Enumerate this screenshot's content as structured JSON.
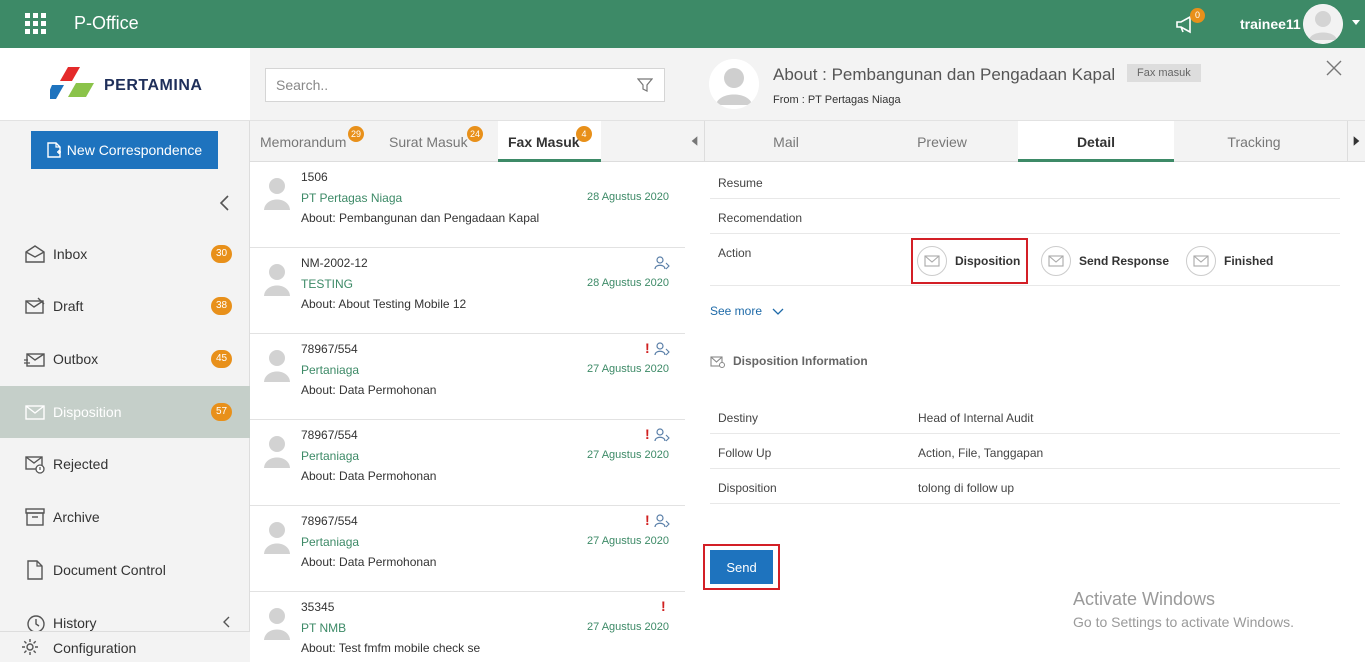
{
  "app": {
    "title": "P-Office",
    "notification_count": "0",
    "username": "trainee11"
  },
  "sidebar": {
    "logo_text": "PERTAMINA",
    "new_button": "New Correspondence",
    "items": [
      {
        "label": "Inbox",
        "badge": "30",
        "icon": "inbox-icon"
      },
      {
        "label": "Draft",
        "badge": "38",
        "icon": "draft-icon"
      },
      {
        "label": "Outbox",
        "badge": "45",
        "icon": "outbox-icon"
      },
      {
        "label": "Disposition",
        "badge": "57",
        "icon": "disposition-icon"
      },
      {
        "label": "Rejected",
        "badge": "",
        "icon": "rejected-icon"
      },
      {
        "label": "Archive",
        "badge": "",
        "icon": "archive-icon"
      },
      {
        "label": "Document Control",
        "badge": "",
        "icon": "document-icon"
      },
      {
        "label": "History",
        "badge": "",
        "icon": "history-icon"
      }
    ],
    "config_label": "Configuration"
  },
  "list": {
    "search_placeholder": "Search..",
    "tabs": [
      {
        "label": "Memorandum",
        "badge": "29"
      },
      {
        "label": "Surat Masuk",
        "badge": "24"
      },
      {
        "label": "Fax Masuk",
        "badge": "4"
      }
    ],
    "items": [
      {
        "number": "1506",
        "sender": "PT Pertagas Niaga",
        "date": "28 Agustus 2020",
        "about": "About: Pembangunan dan Pengadaan Kapal",
        "urgent": "",
        "person": false
      },
      {
        "number": "NM-2002-12",
        "sender": "TESTING",
        "date": "28 Agustus 2020",
        "about": "About: About Testing Mobile 12",
        "urgent": "",
        "person": true
      },
      {
        "number": "78967/554",
        "sender": "Pertaniaga",
        "date": "27 Agustus 2020",
        "about": "About: Data Permohonan",
        "urgent": "!",
        "person": true
      },
      {
        "number": "78967/554",
        "sender": "Pertaniaga",
        "date": "27 Agustus 2020",
        "about": "About: Data Permohonan",
        "urgent": "!",
        "person": true
      },
      {
        "number": "78967/554",
        "sender": "Pertaniaga",
        "date": "27 Agustus 2020",
        "about": "About: Data Permohonan",
        "urgent": "!",
        "person": true
      },
      {
        "number": "35345",
        "sender": "PT NMB",
        "date": "27 Agustus 2020",
        "about": "About: Test fmfm mobile check se",
        "urgent": "!",
        "person": false
      }
    ]
  },
  "detail": {
    "title": "About : Pembangunan dan Pengadaan Kapal",
    "tag": "Fax masuk",
    "from": "From : PT Pertagas Niaga",
    "tabs": [
      "Mail",
      "Preview",
      "Detail",
      "Tracking"
    ],
    "rows": {
      "resume": "Resume",
      "recomendation": "Recomendation",
      "action": "Action"
    },
    "actions": [
      "Disposition",
      "Send Response",
      "Finished"
    ],
    "see_more": "See more",
    "disposition_info_title": "Disposition Information",
    "disposition_rows": [
      {
        "label": "Destiny",
        "value": "Head of Internal Audit"
      },
      {
        "label": "Follow Up",
        "value": "Action, File, Tanggapan"
      },
      {
        "label": "Disposition",
        "value": "tolong di follow up"
      }
    ],
    "send_label": "Send"
  },
  "watermark": {
    "line1": "Activate Windows",
    "line2": "Go to Settings to activate Windows."
  },
  "colors": {
    "header_green": "#3d8a67",
    "badge_orange": "#e8901a",
    "primary_blue": "#1e73be",
    "highlight_red": "#d31f26"
  }
}
